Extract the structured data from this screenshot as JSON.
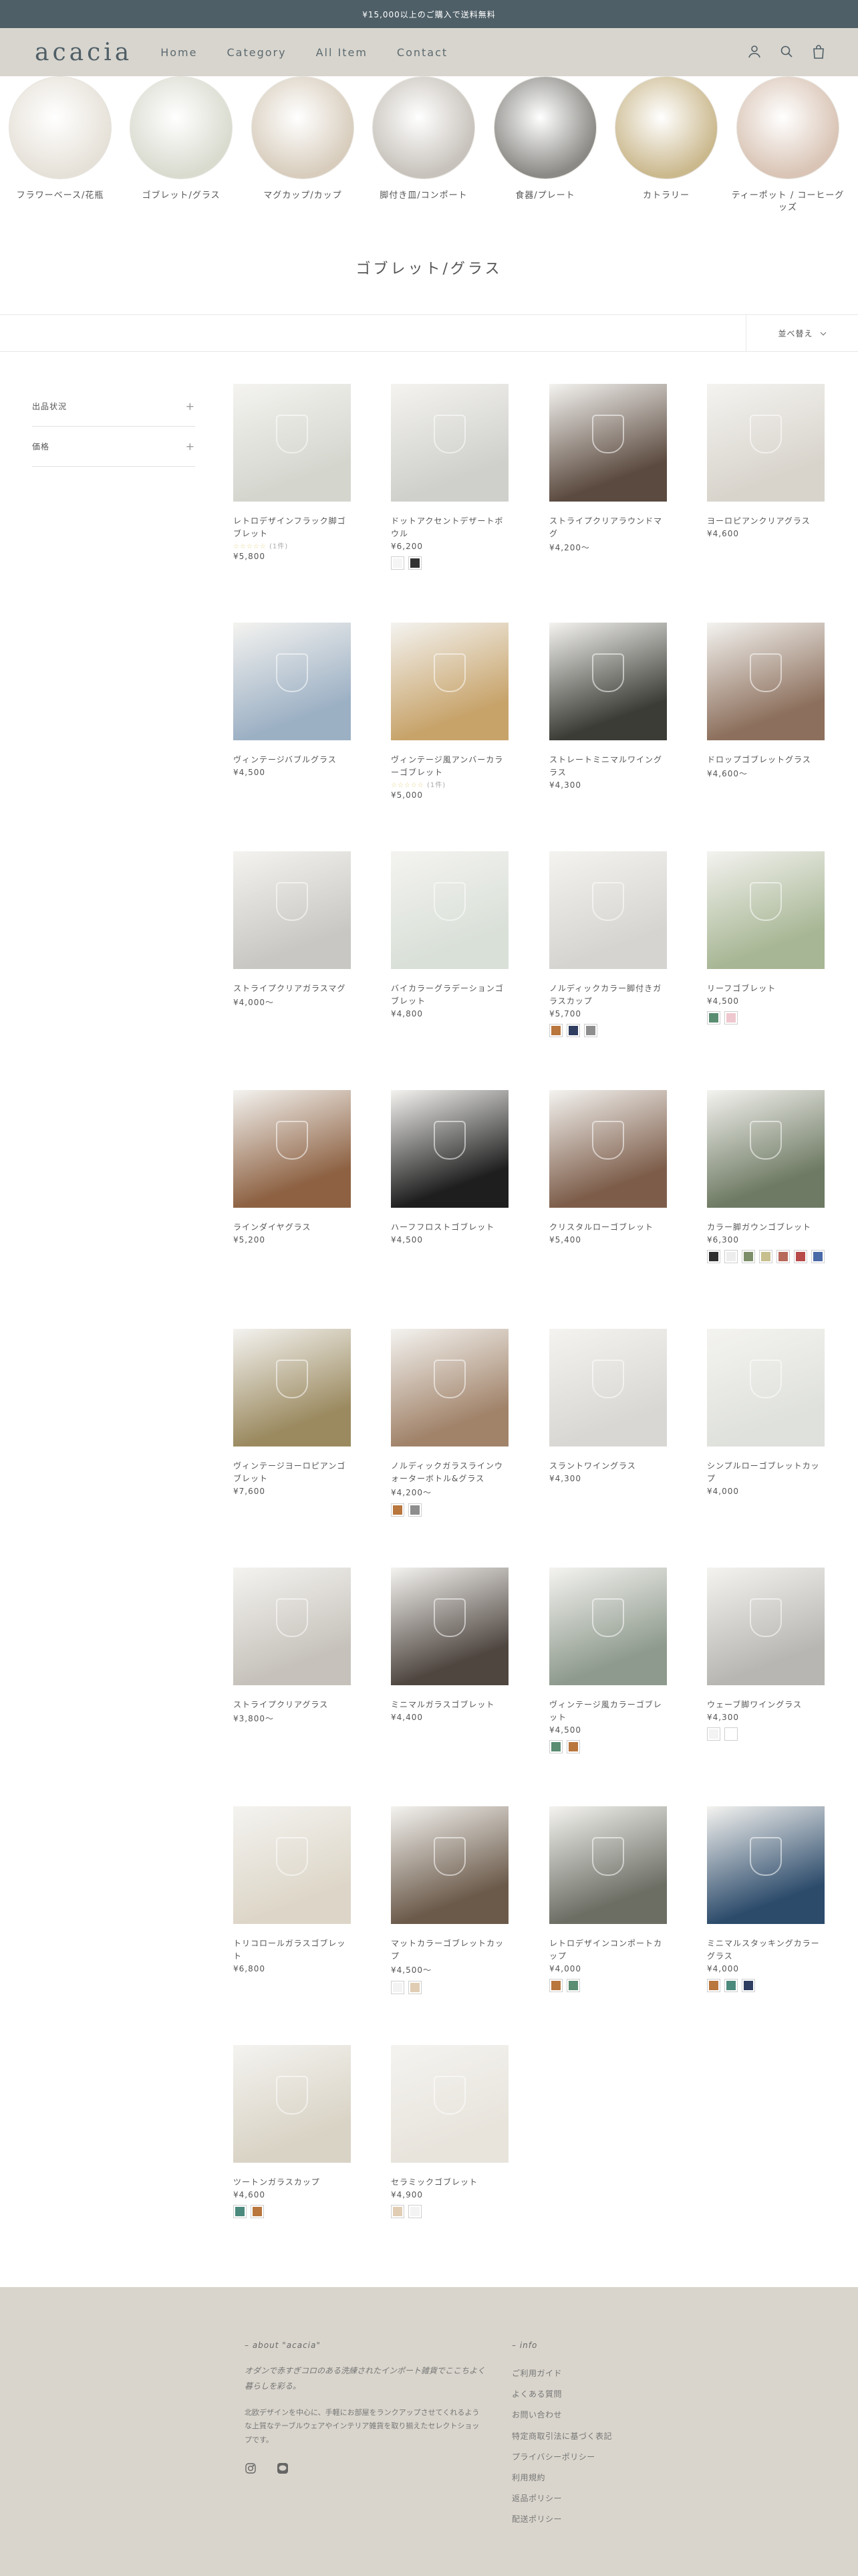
{
  "announcement": "¥15,000以上のご購入で送料無料",
  "header": {
    "logo": "acacia",
    "nav": [
      "Home",
      "Category",
      "All Item",
      "Contact"
    ],
    "icons": [
      "account-icon",
      "search-icon",
      "cart-icon"
    ]
  },
  "categories": [
    {
      "label": "フラワーベース/花瓶",
      "color": "#e6e1d8"
    },
    {
      "label": "ゴブレット/グラス",
      "color": "#d9dbcf"
    },
    {
      "label": "マグカップ/カップ",
      "color": "#d8cdbd"
    },
    {
      "label": "脚付き皿/コンポート",
      "color": "#c7c2bb"
    },
    {
      "label": "食器/プレート",
      "color": "#8b8a86"
    },
    {
      "label": "カトラリー",
      "color": "#cbb98e"
    },
    {
      "label": "ティーポット / コーヒーグッズ",
      "color": "#d9c4b5"
    }
  ],
  "page_title": "ゴブレット/グラス",
  "sort_label": "並べ替え",
  "filters": [
    "出品状況",
    "価格"
  ],
  "products": [
    {
      "name": "レトロデザインフラック脚ゴブレット",
      "price": "¥5,800",
      "review": "(1件)",
      "tone": "#d4d6ce",
      "swatches": []
    },
    {
      "name": "ドットアクセントデザートボウル",
      "price": "¥6,200",
      "tone": "#cfcfcb",
      "swatches": [
        "#f5f5f5",
        "#333333"
      ]
    },
    {
      "name": "ストライプクリアラウンドマグ",
      "price": "¥4,200〜",
      "tone": "#5b4a3f",
      "swatches": []
    },
    {
      "name": "ヨーロピアンクリアグラス",
      "price": "¥4,600",
      "tone": "#d8d4cc",
      "swatches": []
    },
    {
      "name": "ヴィンテージバブルグラス",
      "price": "¥4,500",
      "tone": "#9cb0c4",
      "swatches": []
    },
    {
      "name": "ヴィンテージ風アンバーカラーゴブレット",
      "price": "¥5,000",
      "review": "(1件)",
      "tone": "#c7a36a",
      "swatches": []
    },
    {
      "name": "ストレートミニマルワイングラス",
      "price": "¥4,300",
      "tone": "#3b3c36",
      "swatches": []
    },
    {
      "name": "ドロップゴブレットグラス",
      "price": "¥4,600〜",
      "tone": "#8c6f5c",
      "swatches": []
    },
    {
      "name": "ストライプクリアガラスマグ",
      "price": "¥4,000〜",
      "tone": "#c9c7c3",
      "swatches": []
    },
    {
      "name": "バイカラーグラデーションゴブレット",
      "price": "¥4,800",
      "tone": "#d9e0d8",
      "swatches": []
    },
    {
      "name": "ノルディックカラー脚付きガラスカップ",
      "price": "¥5,700",
      "tone": "#d6d4d0",
      "swatches": [
        "#b9763d",
        "#2f3d60",
        "#8e8e8e"
      ]
    },
    {
      "name": "リーフゴブレット",
      "price": "¥4,500",
      "tone": "#a7b694",
      "swatches": [
        "#5b8d72",
        "#efc7cf"
      ]
    },
    {
      "name": "ラインダイヤグラス",
      "price": "¥5,200",
      "tone": "#8d6142",
      "swatches": []
    },
    {
      "name": "ハーフフロストゴブレット",
      "price": "¥4,500",
      "tone": "#1e1e1e",
      "swatches": []
    },
    {
      "name": "クリスタルローゴブレット",
      "price": "¥5,400",
      "tone": "#7d5d4a",
      "swatches": []
    },
    {
      "name": "カラー脚ガウンゴブレット",
      "price": "¥6,300",
      "tone": "#6e7a63",
      "swatches": [
        "#2f2f2f",
        "#ededed",
        "#7d8f6a",
        "#c7bf8e",
        "#b86a5a",
        "#b84a4a",
        "#4b6aa8"
      ]
    },
    {
      "name": "ヴィンテージヨーロピアンゴブレット",
      "price": "¥7,600",
      "tone": "#9b8a60",
      "swatches": []
    },
    {
      "name": "ノルディックガラスラインウォーターボトル&グラス",
      "price": "¥4,200〜",
      "tone": "#a1836a",
      "swatches": [
        "#b9763d",
        "#8e8e8e"
      ]
    },
    {
      "name": "スラントワイングラス",
      "price": "¥4,300",
      "tone": "#d9d7d3",
      "swatches": []
    },
    {
      "name": "シンプルローゴブレットカップ",
      "price": "¥4,000",
      "tone": "#dfe1dc",
      "swatches": []
    },
    {
      "name": "ストライプクリアグラス",
      "price": "¥3,800〜",
      "tone": "#c6c2bb",
      "swatches": []
    },
    {
      "name": "ミニマルガラスゴブレット",
      "price": "¥4,400",
      "tone": "#4f4640",
      "swatches": []
    },
    {
      "name": "ヴィンテージ風カラーゴブレット",
      "price": "¥4,500",
      "tone": "#8e9a8d",
      "swatches": [
        "#5b8d72",
        "#b9763d"
      ]
    },
    {
      "name": "ウェーブ脚ワイングラス",
      "price": "¥4,300",
      "tone": "#b7b6b2",
      "swatches": [
        "#f3f3f3",
        "#ffffff"
      ]
    },
    {
      "name": "トリコロールガラスゴブレット",
      "price": "¥6,800",
      "tone": "#ddd6c8",
      "swatches": []
    },
    {
      "name": "マットカラーゴブレットカップ",
      "price": "¥4,500〜",
      "tone": "#6b5a4a",
      "swatches": [
        "#f3f3f3",
        "#e0cdb4"
      ]
    },
    {
      "name": "レトロデザインコンポートカップ",
      "price": "¥4,000",
      "tone": "#6c6e64",
      "swatches": [
        "#b9763d",
        "#5b8d72"
      ]
    },
    {
      "name": "ミニマルスタッキングカラーグラス",
      "price": "¥4,000",
      "tone": "#2c4b6b",
      "swatches": [
        "#b9763d",
        "#4c8a7e",
        "#2f3d60"
      ]
    },
    {
      "name": "ツートンガラスカップ",
      "price": "¥4,600",
      "tone": "#d9d3c5",
      "swatches": [
        "#4c8a7e",
        "#b9763d"
      ]
    },
    {
      "name": "セラミックゴブレット",
      "price": "¥4,900",
      "tone": "#e8e4dc",
      "swatches": [
        "#e0cdb4",
        "#f3f3f3"
      ]
    }
  ],
  "footer": {
    "about_heading": "– about \"acacia\"",
    "about_tagline": "オダンで赤すぎコロのある洗練されたインポート雑貨でここちよく暮らしを彩る。",
    "about_desc": "北欧デザインを中心に、手軽にお部屋をランクアップさせてくれるような上質なテーブルウェアやインテリア雑貨を取り揃えたセレクトショップです。",
    "info_heading": "– info",
    "info_links": [
      "ご利用ガイド",
      "よくある質問",
      "お問い合わせ",
      "特定商取引法に基づく表記",
      "プライバシーポリシー",
      "利用規約",
      "返品ポリシー",
      "配送ポリシー"
    ],
    "social": [
      "instagram-icon",
      "line-icon"
    ]
  }
}
